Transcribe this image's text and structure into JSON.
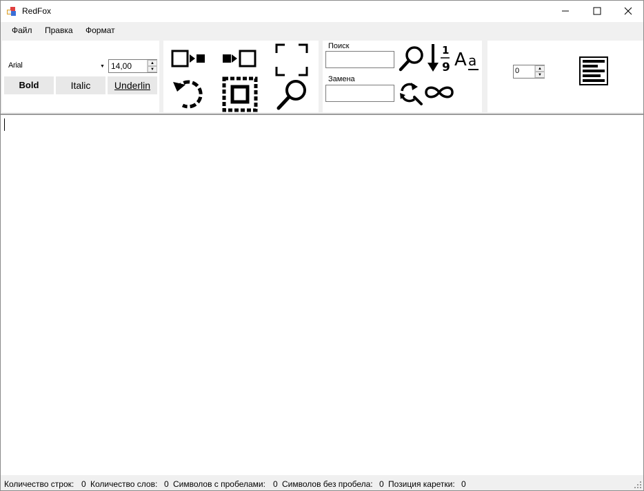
{
  "window": {
    "title": "RedFox"
  },
  "menu": {
    "items": [
      "Файл",
      "Правка",
      "Формат"
    ]
  },
  "font": {
    "name": "Arial",
    "size": "14,00",
    "bold_label": "Bold",
    "italic_label": "Italic",
    "underline_label": "Underlin"
  },
  "search": {
    "search_label": "Поиск",
    "search_value": "",
    "replace_label": "Замена",
    "replace_value": ""
  },
  "indent": {
    "value": "0"
  },
  "editor": {
    "content": ""
  },
  "status": {
    "lines_label": "Количество строк:",
    "lines_value": "0",
    "words_label": "Количество слов:",
    "words_value": "0",
    "chars_with_spaces_label": "Символов с пробелами:",
    "chars_with_spaces_value": "0",
    "chars_without_spaces_label": "Символов без пробела:",
    "chars_without_spaces_value": "0",
    "caret_label": "Позиция каретки:",
    "caret_value": "0"
  },
  "icons": {
    "app": "app-icon",
    "toolbar": [
      "move-right-icon",
      "move-left-icon",
      "select-frame-icon",
      "undo-icon",
      "select-all-icon",
      "zoom-icon",
      "search-icon",
      "sort-numeric-icon",
      "match-case-icon",
      "replace-icon",
      "infinity-icon",
      "align-icon"
    ]
  },
  "colors": {
    "chrome": "#f0f0f0",
    "panel": "#ffffff",
    "button": "#e8e8e8"
  }
}
